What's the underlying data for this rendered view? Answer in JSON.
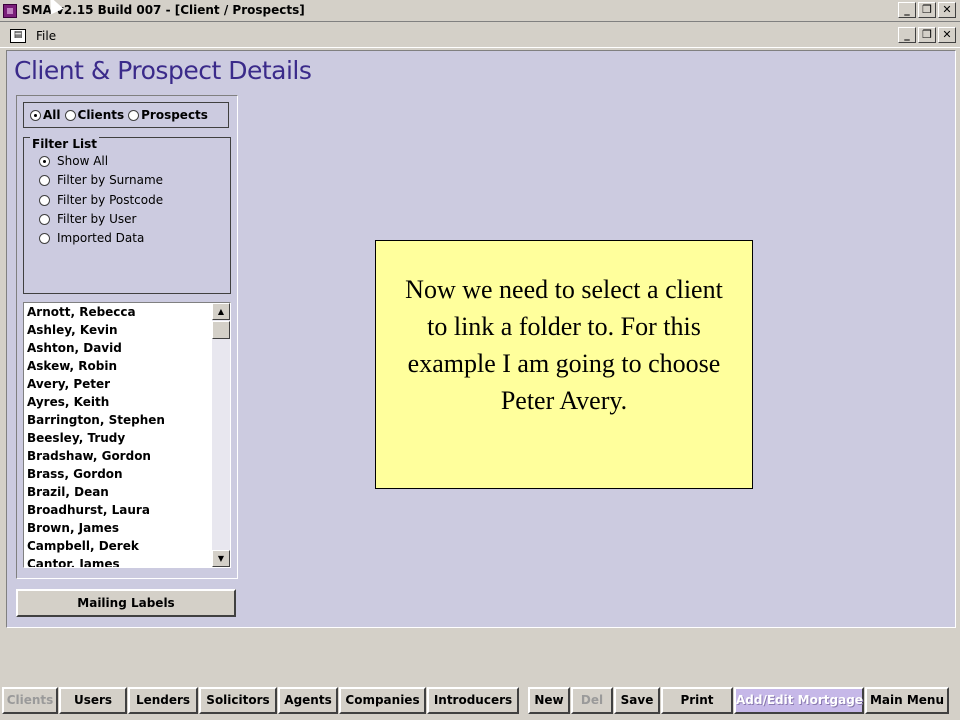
{
  "window": {
    "title": "SMA v2.15 Build 007 - [Client / Prospects]",
    "controls": [
      "_",
      "❐",
      "✕"
    ]
  },
  "menu": {
    "file_label": "File"
  },
  "form": {
    "title": "Client & Prospect Details",
    "type_filter": {
      "options": [
        "All",
        "Clients",
        "Prospects"
      ],
      "selected": "All"
    },
    "filter_list": {
      "title": "Filter List",
      "options": [
        "Show All",
        "Filter by Surname",
        "Filter by Postcode",
        "Filter by User",
        "Imported Data"
      ],
      "selected": "Show All"
    },
    "clients": [
      "Arnott, Rebecca",
      "Ashley, Kevin",
      "Ashton, David",
      "Askew, Robin",
      "Avery, Peter",
      "Ayres, Keith",
      "Barrington, Stephen",
      "Beesley, Trudy",
      "Bradshaw, Gordon",
      "Brass, Gordon",
      "Brazil, Dean",
      "Broadhurst, Laura",
      "Brown, James",
      "Campbell, Derek",
      "Cantor, James"
    ],
    "mailing_labels_button": "Mailing Labels"
  },
  "note": {
    "text": "Now we need to select a client to link a folder to. For this example I am going to choose Peter Avery."
  },
  "bottom_buttons": [
    {
      "label": "Clients",
      "state": "active"
    },
    {
      "label": "Users",
      "state": "normal"
    },
    {
      "label": "Lenders",
      "state": "normal"
    },
    {
      "label": "Solicitors",
      "state": "normal"
    },
    {
      "label": "Agents",
      "state": "normal"
    },
    {
      "label": "Companies",
      "state": "normal"
    },
    {
      "label": "Introducers",
      "state": "normal"
    },
    {
      "label": "New",
      "state": "normal"
    },
    {
      "label": "Del",
      "state": "disabled"
    },
    {
      "label": "Save",
      "state": "normal"
    },
    {
      "label": "Print",
      "state": "normal"
    },
    {
      "label": "Add/Edit Mortgage",
      "state": "highlighted"
    },
    {
      "label": "Main Menu",
      "state": "normal"
    }
  ],
  "colors": {
    "form_background": "#cccbe0",
    "title_text": "#3a2a8a",
    "note_background": "#ffff9c",
    "highlight_button": "#c6b8e8"
  }
}
